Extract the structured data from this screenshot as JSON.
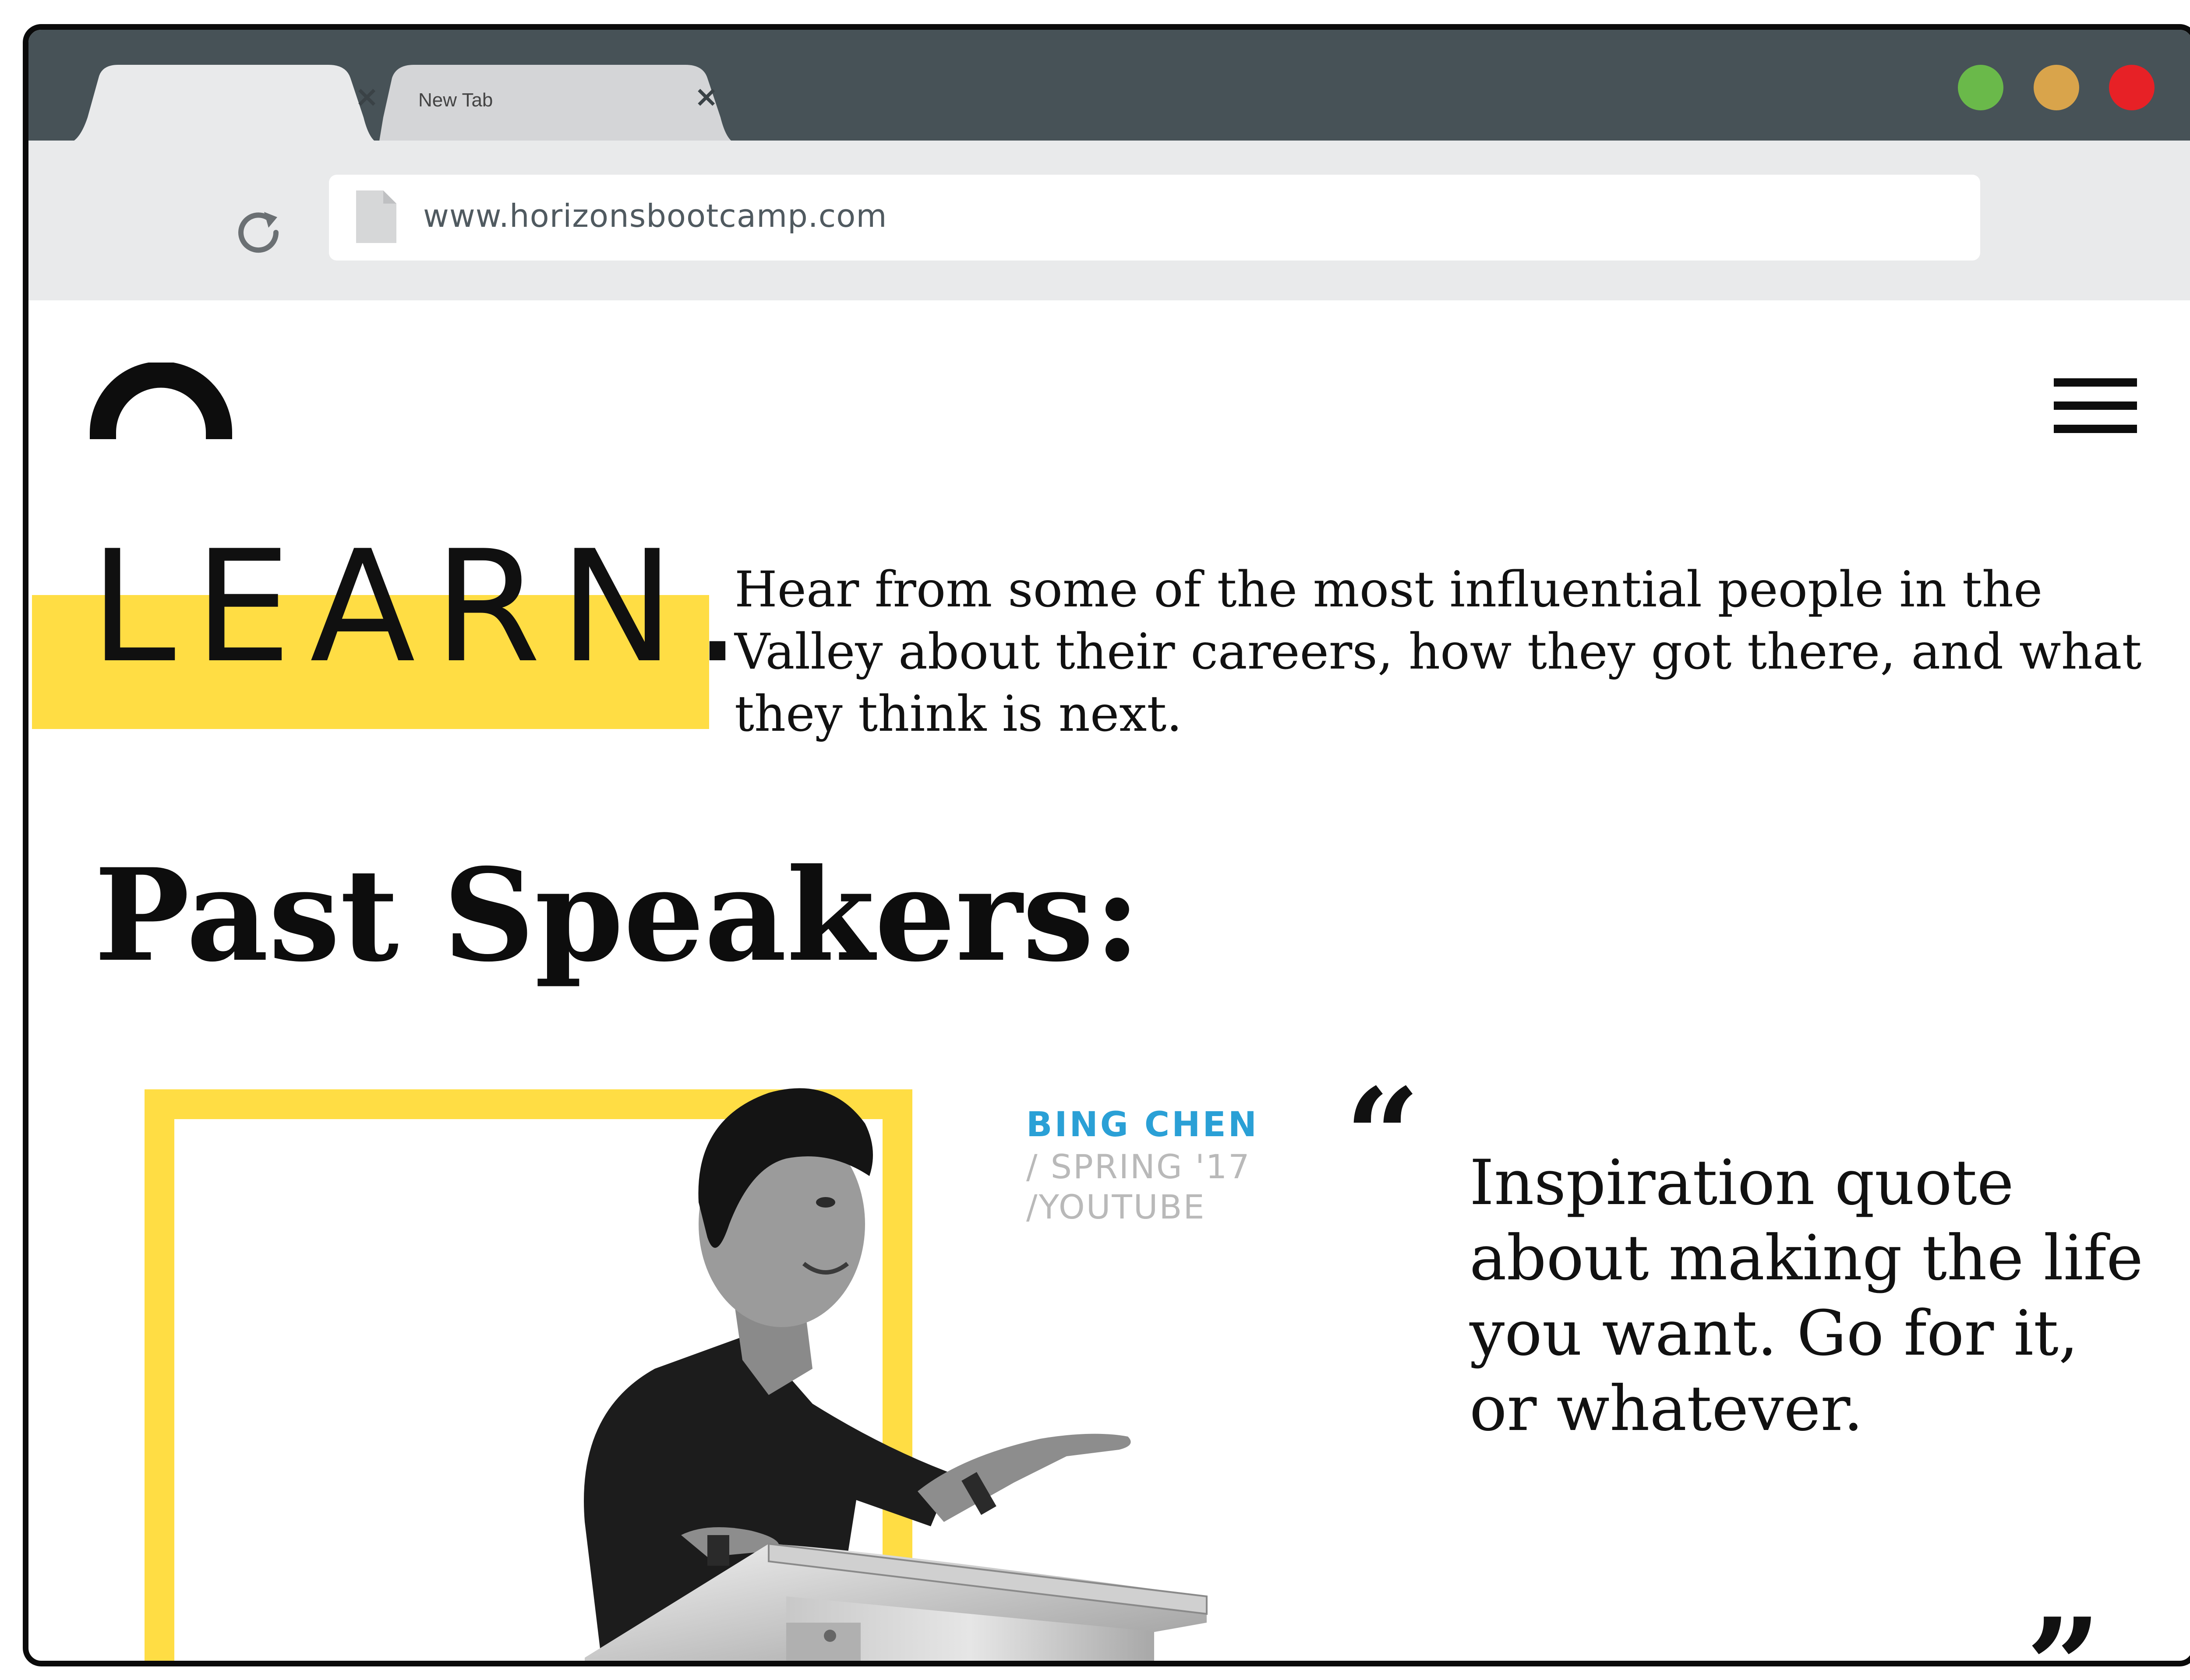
{
  "browser": {
    "tabs": [
      {
        "title": "",
        "close_glyph": "×",
        "active": true
      },
      {
        "title": "New Tab",
        "close_glyph": "×",
        "active": false
      }
    ],
    "window_controls": [
      {
        "name": "green-light",
        "color": "#6ab94a"
      },
      {
        "name": "yellow-light",
        "color": "#d9a44b"
      },
      {
        "name": "red-light",
        "color": "#e72126"
      }
    ],
    "address_bar": {
      "url": "www.horizonsbootcamp.com"
    },
    "icons": [
      "reload-icon",
      "page-icon",
      "close-icon"
    ]
  },
  "site": {
    "logo_icon": "horizon-arc-logo",
    "menu_icon": "hamburger-menu-icon",
    "hero": {
      "heading": "LEARN.",
      "intro": "Hear from some of the most influential people in the Valley about their careers, how they got there, and what they think is next."
    },
    "speakers_title": "Past Speakers:",
    "speaker": {
      "name": "BING CHEN",
      "term": "/ SPRING '17",
      "company": "/YOUTUBE",
      "quote_open": "“",
      "quote": "Inspiration quote about making the life you want. Go for it, or whatever.",
      "quote_close": "”"
    }
  },
  "colors": {
    "accent_yellow": "#ffdd44",
    "name_blue": "#2aa0d6",
    "tabbar": "#475257",
    "toolbar": "#e9eaeb",
    "meta_gray": "#b9b9b9"
  }
}
